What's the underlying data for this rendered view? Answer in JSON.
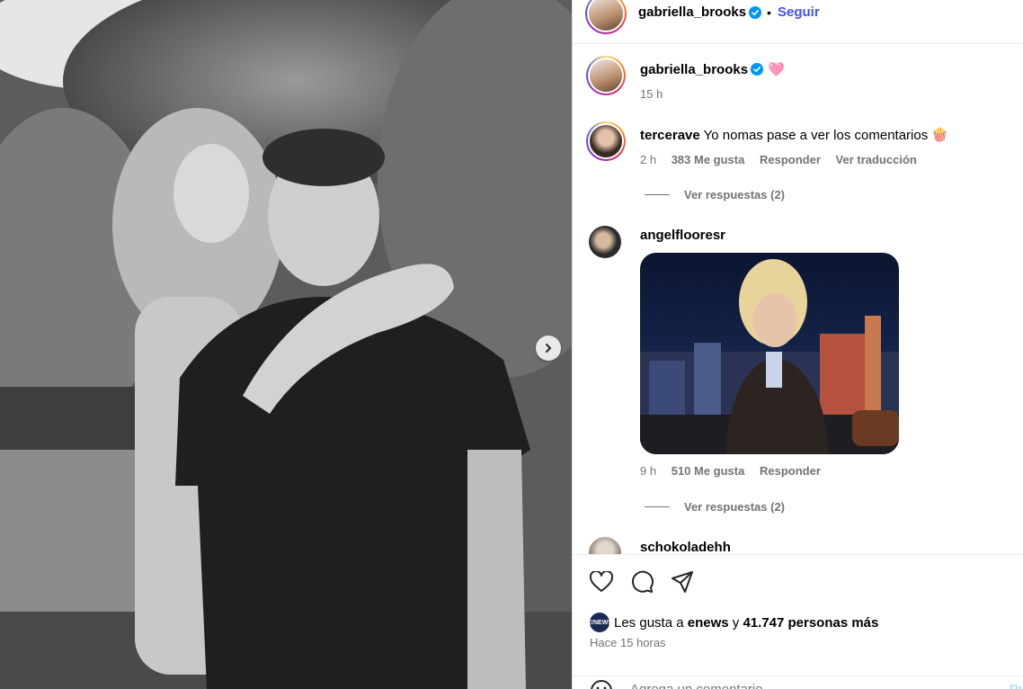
{
  "header": {
    "username": "gabriella_brooks",
    "separator": "•",
    "follow_label": "Seguir"
  },
  "caption": {
    "username": "gabriella_brooks",
    "emoji": "🩷",
    "time": "15 h"
  },
  "comments": [
    {
      "username": "tercerave",
      "text": "Yo nomas pase a ver los comentarios 🍿",
      "time": "2 h",
      "likes": "383 Me gusta",
      "reply_label": "Responder",
      "translate_label": "Ver traducción",
      "view_replies": "Ver respuestas (2)"
    },
    {
      "username": "angelflooresr",
      "time": "9 h",
      "likes": "510 Me gusta",
      "reply_label": "Responder",
      "view_replies": "Ver respuestas (2)"
    },
    {
      "username": "schokoladehh"
    }
  ],
  "actions": {
    "likes_prefix": "Les gusta a",
    "likes_user": "enews",
    "likes_connector": "y",
    "likes_count": "41.747 personas más",
    "time_ago": "Hace 15 horas",
    "mini_avatar_text": "E!NEWS"
  },
  "add_comment": {
    "placeholder": "Agrega un comentario...",
    "post_label": "Publicar"
  },
  "colors": {
    "accent": "#4150f7",
    "verified": "#0095f6",
    "muted": "#737373"
  },
  "icons": [
    "chevron-right-icon",
    "verified-icon",
    "heart-icon",
    "comment-icon",
    "share-icon",
    "emoji-icon"
  ]
}
